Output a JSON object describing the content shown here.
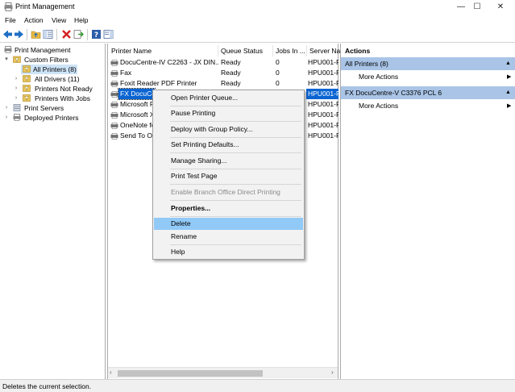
{
  "window": {
    "title": "Print Management",
    "icon": "printer-management-icon",
    "buttons": {
      "minimize": "—",
      "maximize": "☐",
      "close": "✕"
    }
  },
  "menu": [
    "File",
    "Action",
    "View",
    "Help"
  ],
  "toolbar": {
    "icons": [
      "back-icon",
      "forward-icon",
      "up-folder-icon",
      "show-hide-tree-icon",
      "delete-icon",
      "export-icon",
      "help-icon",
      "show-hide-action-pane-icon"
    ]
  },
  "tree": {
    "root": "Print Management",
    "custom_filters": "Custom Filters",
    "all_printers": "All Printers (8)",
    "all_drivers": "All Drivers (11)",
    "printers_not_ready": "Printers Not Ready",
    "printers_with_jobs": "Printers With Jobs",
    "print_servers": "Print Servers",
    "deployed_printers": "Deployed Printers"
  },
  "list": {
    "columns": [
      "Printer Name",
      "Queue Status",
      "Jobs In ...",
      "Server Nar"
    ],
    "rows": [
      {
        "name": "DocuCentre-IV C2263 - JX DIN...",
        "status": "Ready",
        "jobs": "0",
        "server": "HPU001-P"
      },
      {
        "name": "Fax",
        "status": "Ready",
        "jobs": "0",
        "server": "HPU001-P"
      },
      {
        "name": "Foxit Reader PDF Printer",
        "status": "Ready",
        "jobs": "0",
        "server": "HPU001-P"
      },
      {
        "name": "FX DocuCe",
        "status": "",
        "jobs": "",
        "server": "HPU001-P"
      },
      {
        "name": "Microsoft P",
        "status": "",
        "jobs": "",
        "server": "HPU001-P"
      },
      {
        "name": "Microsoft X",
        "status": "",
        "jobs": "",
        "server": "HPU001-P"
      },
      {
        "name": "OneNote fo",
        "status": "",
        "jobs": "",
        "server": "HPU001-P"
      },
      {
        "name": "Send To On",
        "status": "",
        "jobs": "",
        "server": "HPU001-P"
      }
    ]
  },
  "actions": {
    "header": "Actions",
    "section1": {
      "title": "All Printers (8)",
      "item": "More Actions"
    },
    "section2": {
      "title": "FX DocuCentre-V C3376 PCL 6",
      "item": "More Actions"
    }
  },
  "context_menu": {
    "items": [
      "Open Printer Queue...",
      "Pause Printing",
      "Deploy with Group Policy...",
      "Set Printing Defaults...",
      "Manage Sharing...",
      "Print Test Page",
      "Enable Branch Office Direct Printing",
      "Properties...",
      "Delete",
      "Rename",
      "Help"
    ],
    "highlighted": "Delete"
  },
  "status": "Deletes the current selection.",
  "colors": {
    "selection": "#cde3f7",
    "menu_highlight": "#91c9f7",
    "action_section": "#a9c4e6"
  }
}
